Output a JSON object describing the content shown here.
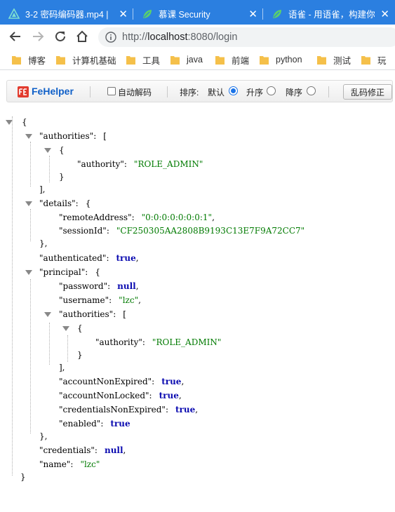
{
  "tabs": [
    {
      "title": "3-2 密码编码器.mp4 |",
      "icon": "play-triangle-icon",
      "active": false
    },
    {
      "title": "慕课 Security",
      "icon": "leaf-icon",
      "active": true
    },
    {
      "title": "语雀 - 用语雀，构建你",
      "icon": "leaf-icon",
      "active": false
    }
  ],
  "tab_close": "✕",
  "address": {
    "scheme_host": "http://",
    "host": "localhost",
    "rest": ":8080/login"
  },
  "bookmarks": [
    "博客",
    "计算机基础",
    "工具",
    "java",
    "前端",
    "python",
    "测试",
    "玩"
  ],
  "fehelper": {
    "name": "FeHelper",
    "auto_decode": "自动解码",
    "sort_label": "排序:",
    "sort_default": "默认",
    "sort_asc": "升序",
    "sort_desc": "降序",
    "fix_button": "乱码修正"
  },
  "json": {
    "open_brace": "{",
    "close_brace": "}",
    "authorities_key": "\"authorities\":",
    "open_bracket": "[",
    "close_bracket_comma": "],",
    "close_bracket": "],",
    "authority_key": "\"authority\":",
    "role_admin": "\"ROLE_ADMIN\"",
    "details_key": "\"details\":",
    "remote_address_key": "\"remoteAddress\":",
    "remote_address_val": "\"0:0:0:0:0:0:0:1\"",
    "session_id_key": "\"sessionId\":",
    "session_id_val": "\"CF250305AA2808B9193C13E7F9A72CC7\"",
    "close_obj_comma": "},",
    "authenticated_key": "\"authenticated\":",
    "true_val": "true",
    "null_val": "null",
    "principal_key": "\"principal\":",
    "password_key": "\"password\":",
    "username_key": "\"username\":",
    "username_val": "\"lzc\"",
    "account_non_expired_key": "\"accountNonExpired\":",
    "account_non_locked_key": "\"accountNonLocked\":",
    "credentials_non_expired_key": "\"credentialsNonExpired\":",
    "enabled_key": "\"enabled\":",
    "credentials_key": "\"credentials\":",
    "name_key": "\"name\":",
    "name_val": "\"lzc\"",
    "comma": ","
  },
  "colors": {
    "tab_bar": "#2b7fe0",
    "json_string": "#007a00",
    "json_bool": "#0b0bb0",
    "fe_blue": "#1060c8"
  }
}
